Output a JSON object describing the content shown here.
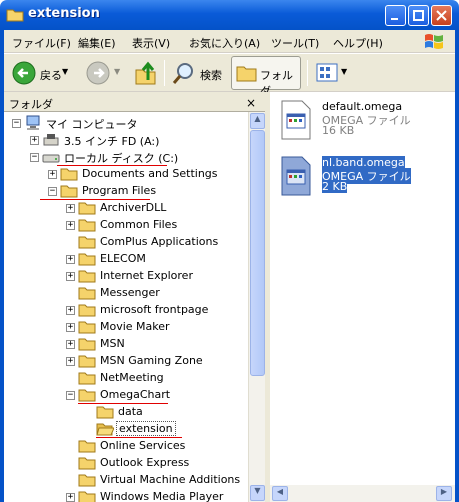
{
  "window": {
    "title": "extension"
  },
  "menu": [
    "ファイル(F)",
    "編集(E)",
    "表示(V)",
    "お気に入り(A)",
    "ツール(T)",
    "ヘルプ(H)"
  ],
  "toolbar": {
    "back": "戻る",
    "search": "検索",
    "folders": "フォルダ"
  },
  "folder_pane": {
    "title": "フォルダ",
    "close": "×"
  },
  "tree": [
    {
      "label": "マイ コンピュータ",
      "expander": "−"
    },
    {
      "label": "3.5 インチ FD (A:)",
      "expander": "+"
    },
    {
      "label": "ローカル ディスク (C:)",
      "expander": "−"
    },
    {
      "label": "Documents and Settings",
      "expander": "+"
    },
    {
      "label": "Program Files",
      "expander": "−"
    },
    {
      "label": "ArchiverDLL",
      "expander": "+"
    },
    {
      "label": "Common Files",
      "expander": "+"
    },
    {
      "label": "ComPlus Applications",
      "expander": ""
    },
    {
      "label": "ELECOM",
      "expander": "+"
    },
    {
      "label": "Internet Explorer",
      "expander": "+"
    },
    {
      "label": "Messenger",
      "expander": ""
    },
    {
      "label": "microsoft frontpage",
      "expander": "+"
    },
    {
      "label": "Movie Maker",
      "expander": "+"
    },
    {
      "label": "MSN",
      "expander": "+"
    },
    {
      "label": "MSN Gaming Zone",
      "expander": "+"
    },
    {
      "label": "NetMeeting",
      "expander": ""
    },
    {
      "label": "OmegaChart",
      "expander": "−"
    },
    {
      "label": "data",
      "expander": ""
    },
    {
      "label": "extension",
      "expander": ""
    },
    {
      "label": "Online Services",
      "expander": ""
    },
    {
      "label": "Outlook Express",
      "expander": ""
    },
    {
      "label": "Virtual Machine Additions",
      "expander": ""
    },
    {
      "label": "Windows Media Player",
      "expander": "+"
    }
  ],
  "files": [
    {
      "name": "default.omega",
      "type": "OMEGA ファイル",
      "size": "16 KB"
    },
    {
      "name": "nl.band.omega",
      "type": "OMEGA ファイル",
      "size": "2 KB"
    }
  ],
  "colors": {
    "selection": "#316ac5",
    "annotation": "#e00000",
    "titlebar": "#0452c8"
  }
}
